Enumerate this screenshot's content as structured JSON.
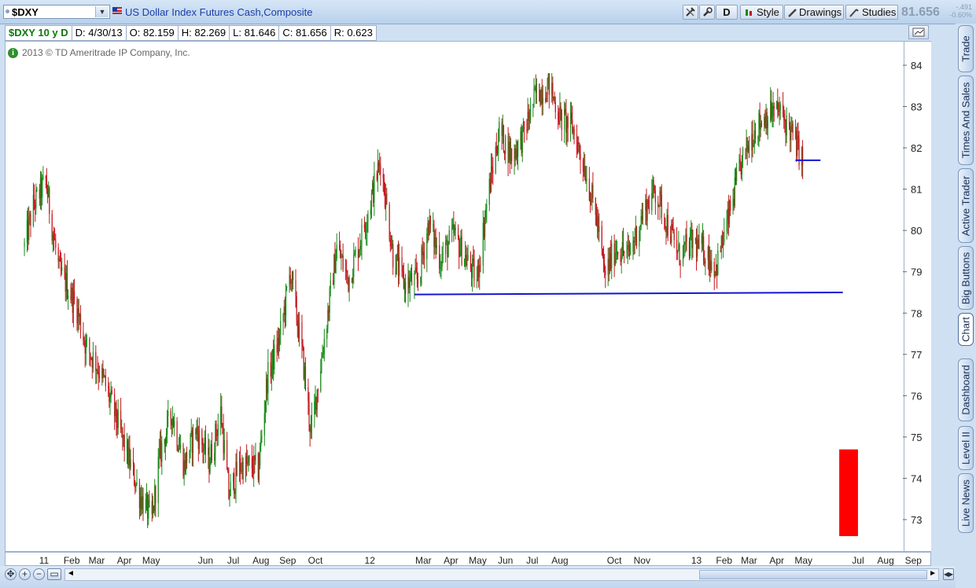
{
  "toolbar": {
    "symbol": "$DXY",
    "description": "US Dollar Index Futures Cash,Composite",
    "period_button": "D",
    "style_label": "Style",
    "drawings_label": "Drawings",
    "studies_label": "Studies",
    "last_price": "81.656",
    "net_change": "-.491",
    "pct_change": "-0.60%"
  },
  "infobar": {
    "study": "$DXY 10 y D",
    "date": "D: 4/30/13",
    "open": "O: 82.159",
    "high": "H: 82.269",
    "low": "L: 81.646",
    "close": "C: 81.656",
    "range": "R: 0.623"
  },
  "copyright": "2013 © TD Ameritrade IP Company, Inc.",
  "side_tabs": [
    "Trade",
    "Times And Sales",
    "Active Trader",
    "Big Buttons",
    "Chart",
    "Dashboard",
    "Level II",
    "Live News"
  ],
  "colors": {
    "up": "#1a8a1a",
    "down": "#c4161c",
    "trendline": "#1414d2",
    "marker": "#ff0000"
  },
  "chart_data": {
    "type": "candlestick",
    "ylim": [
      72.3,
      84.6
    ],
    "y_ticks": [
      73,
      74,
      75,
      76,
      77,
      78,
      79,
      80,
      81,
      82,
      83,
      84
    ],
    "x_tick_labels": [
      "11",
      "Feb",
      "Mar",
      "Apr",
      "May",
      "Jun",
      "Jul",
      "Aug",
      "Sep",
      "Oct",
      "12",
      "Mar",
      "Apr",
      "May",
      "Jun",
      "Jul",
      "Aug",
      "Oct",
      "Nov",
      "13",
      "Feb",
      "Mar",
      "Apr",
      "May",
      "Jul",
      "Aug",
      "Sep"
    ],
    "x_tick_dates": [
      "2011-01-01",
      "2011-02-01",
      "2011-03-01",
      "2011-04-01",
      "2011-05-01",
      "2011-07-01",
      "2011-08-01",
      "2011-09-01",
      "2011-10-01",
      "2011-11-01",
      "2012-01-01",
      "2012-03-01",
      "2012-04-01",
      "2012-05-01",
      "2012-06-01",
      "2012-07-01",
      "2012-08-01",
      "2012-10-01",
      "2012-11-01",
      "2013-01-01",
      "2013-02-01",
      "2013-03-01",
      "2013-04-01",
      "2013-05-01",
      "2013-07-01",
      "2013-08-01",
      "2013-09-01"
    ],
    "price_path": [
      [
        "2010-12-10",
        79.6
      ],
      [
        "2010-12-20",
        80.6
      ],
      [
        "2011-01-03",
        81.2
      ],
      [
        "2011-01-10",
        80.1
      ],
      [
        "2011-01-18",
        79.0
      ],
      [
        "2011-01-26",
        78.7
      ],
      [
        "2011-02-07",
        78.1
      ],
      [
        "2011-02-17",
        77.2
      ],
      [
        "2011-02-28",
        76.8
      ],
      [
        "2011-03-10",
        76.3
      ],
      [
        "2011-03-22",
        75.5
      ],
      [
        "2011-04-04",
        74.6
      ],
      [
        "2011-04-18",
        73.6
      ],
      [
        "2011-05-02",
        73.0
      ],
      [
        "2011-05-10",
        74.5
      ],
      [
        "2011-05-24",
        75.6
      ],
      [
        "2011-06-07",
        74.3
      ],
      [
        "2011-06-20",
        75.2
      ],
      [
        "2011-07-05",
        74.4
      ],
      [
        "2011-07-18",
        75.6
      ],
      [
        "2011-07-27",
        73.6
      ],
      [
        "2011-08-08",
        74.3
      ],
      [
        "2011-08-22",
        74.3
      ],
      [
        "2011-08-29",
        74.2
      ],
      [
        "2011-09-08",
        76.4
      ],
      [
        "2011-09-22",
        77.4
      ],
      [
        "2011-10-04",
        79.0
      ],
      [
        "2011-10-18",
        76.9
      ],
      [
        "2011-10-27",
        75.1
      ],
      [
        "2011-11-08",
        76.9
      ],
      [
        "2011-11-25",
        79.6
      ],
      [
        "2011-12-08",
        78.8
      ],
      [
        "2011-12-27",
        80.2
      ],
      [
        "2012-01-13",
        81.7
      ],
      [
        "2012-01-27",
        79.4
      ],
      [
        "2012-02-09",
        78.7
      ],
      [
        "2012-02-24",
        78.8
      ],
      [
        "2012-03-07",
        80.2
      ],
      [
        "2012-03-20",
        79.3
      ],
      [
        "2012-04-04",
        79.9
      ],
      [
        "2012-04-18",
        79.3
      ],
      [
        "2012-04-30",
        78.8
      ],
      [
        "2012-05-12",
        80.8
      ],
      [
        "2012-05-25",
        82.4
      ],
      [
        "2012-06-08",
        81.8
      ],
      [
        "2012-06-21",
        82.3
      ],
      [
        "2012-07-05",
        83.3
      ],
      [
        "2012-07-20",
        83.5
      ],
      [
        "2012-08-02",
        82.7
      ],
      [
        "2012-08-15",
        82.5
      ],
      [
        "2012-08-29",
        81.5
      ],
      [
        "2012-09-12",
        80.2
      ],
      [
        "2012-09-20",
        78.9
      ],
      [
        "2012-10-03",
        79.6
      ],
      [
        "2012-10-17",
        79.4
      ],
      [
        "2012-11-02",
        80.4
      ],
      [
        "2012-11-15",
        81.0
      ],
      [
        "2012-11-29",
        80.2
      ],
      [
        "2012-12-12",
        79.4
      ],
      [
        "2012-12-27",
        79.7
      ],
      [
        "2013-01-10",
        79.5
      ],
      [
        "2013-01-23",
        79.1
      ],
      [
        "2013-02-06",
        80.3
      ],
      [
        "2013-02-20",
        81.6
      ],
      [
        "2013-03-06",
        82.4
      ],
      [
        "2013-03-20",
        82.8
      ],
      [
        "2013-04-03",
        82.9
      ],
      [
        "2013-04-17",
        82.4
      ],
      [
        "2013-04-30",
        81.7
      ]
    ],
    "trendlines": [
      {
        "from": [
          "2012-02-20",
          78.45
        ],
        "to": [
          "2013-06-14",
          78.5
        ]
      },
      {
        "from": [
          "2013-04-22",
          81.7
        ],
        "to": [
          "2013-05-20",
          81.7
        ]
      }
    ],
    "marker": {
      "from_date": "2013-06-10",
      "to_date": "2013-07-01",
      "from_value": 72.6,
      "to_value": 74.7
    }
  }
}
